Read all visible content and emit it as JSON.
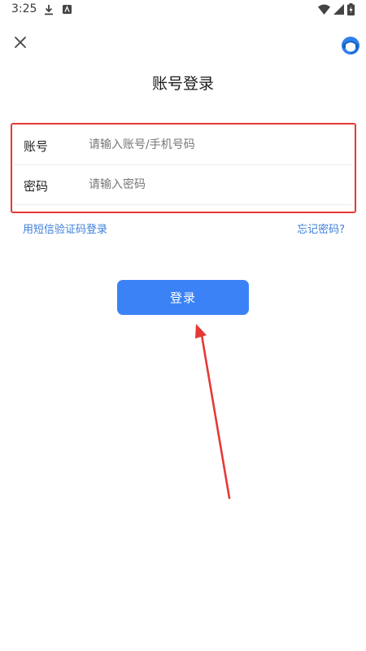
{
  "status_bar": {
    "time": "3:25",
    "icons": [
      "download-icon",
      "app-notification-icon",
      "wifi-icon",
      "signal-icon",
      "battery-charging-icon"
    ]
  },
  "header": {
    "close_icon": "close-icon",
    "support_icon": "customer-service-icon",
    "title": "账号登录"
  },
  "form": {
    "account": {
      "label": "账号",
      "value": "",
      "placeholder": "请输入账号/手机号码"
    },
    "password": {
      "label": "密码",
      "value": "",
      "placeholder": "请输入密码"
    }
  },
  "links": {
    "sms_login": "用短信验证码登录",
    "forgot_password": "忘记密码?"
  },
  "login_button": {
    "label": "登录"
  },
  "colors": {
    "accent": "#3b82f6",
    "link": "#3d7fd9",
    "annotation": "#e53935"
  }
}
